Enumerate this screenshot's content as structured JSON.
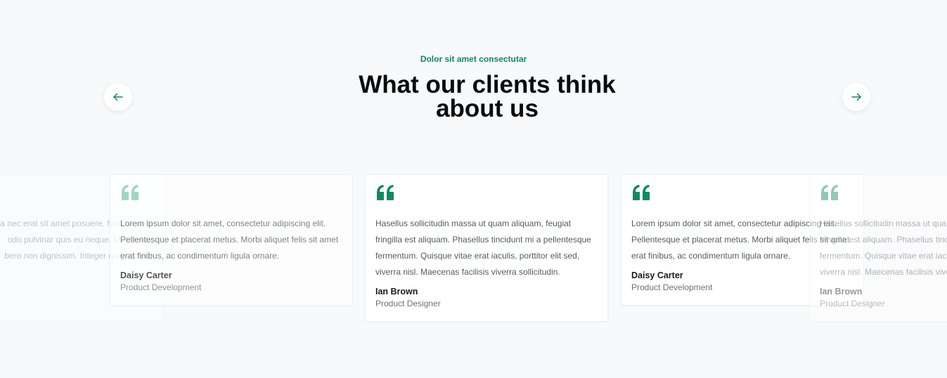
{
  "section": {
    "eyebrow": "Dolor sit amet consectutar",
    "title": "What our clients think about us"
  },
  "nav": {
    "prev_icon": "arrow-left-icon",
    "next_icon": "arrow-right-icon"
  },
  "colors": {
    "accent": "#0c8b5f",
    "accent_light": "#7dcaae",
    "background": "#f8f9fb"
  },
  "testimonials": [
    {
      "text": "Lorem ipsum dolor sit amet, consectetur adipiscing elit. Pellentesque et placerat metus. Morbi aliquet felis sit amet erat finibus, ac condimentum ligula ornare.",
      "name": "Daisy Carter",
      "role": "Product Development"
    },
    {
      "text": "Hasellus sollicitudin massa ut quam aliquam, feugiat fringilla est aliquam. Phasellus tincidunt mi a pellentesque fermentum. Quisque vitae erat iaculis, porttitor elit sed, viverra nisl. Maecenas facilisis viverra sollicitudin.",
      "name": "Ian Brown",
      "role": "Product Designer"
    },
    {
      "text": "Lorem ipsum dolor sit amet, consectetur adipiscing elit. Pellentesque et placerat metus. Morbi aliquet felis sit amet erat finibus, ac condimentum ligula ornare.",
      "name": "Daisy Carter",
      "role": "Product Development"
    },
    {
      "text": "Hasellus sollicitudin massa ut quam aliquam, feugiat fringilla est aliquam. Phasellus tincidunt mi a pellentesque fermentum. Quisque vitae erat iaculis, porttitor elit sed, viverra nisl. Maecenas facilisis viverra sollicitudin.",
      "name": "Ian Brown",
      "role": "Product Designer"
    }
  ],
  "partial_left_card": {
    "lines": [
      "a nec erat sit amet posuere. Nam id ante",
      "odo pulvinar quis eu neque. Maecenas",
      "bero non dignissim. Integer quis tempor"
    ]
  }
}
